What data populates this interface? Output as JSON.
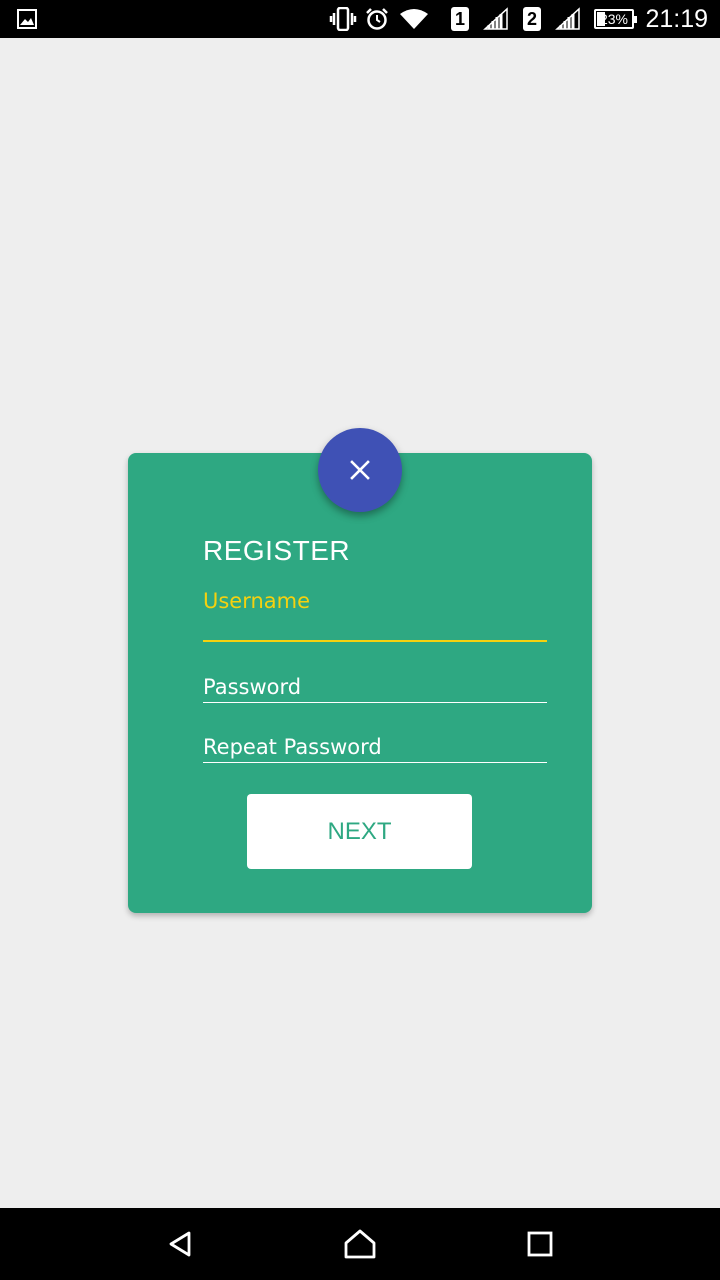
{
  "status_bar": {
    "time": "21:19",
    "battery_percent": "23%",
    "sim1_label": "1",
    "sim2_label": "2",
    "icons": [
      "image-icon",
      "vibrate-icon",
      "alarm-icon",
      "wifi-icon",
      "signal-icon",
      "signal-icon",
      "battery-icon"
    ]
  },
  "dialog": {
    "close_icon": "close-icon",
    "title": "REGISTER",
    "fields": {
      "username": {
        "label": "Username",
        "value": ""
      },
      "password": {
        "label": "Password",
        "value": ""
      },
      "repeat_password": {
        "label": "Repeat Password",
        "value": ""
      }
    },
    "next_label": "NEXT"
  },
  "nav_bar": {
    "icons": [
      "back-icon",
      "home-icon",
      "recents-icon"
    ]
  },
  "colors": {
    "background": "#eeeeee",
    "card": "#2ea882",
    "fab": "#3f51b5",
    "active_field": "#f5d10f",
    "button": "#ffffff"
  }
}
